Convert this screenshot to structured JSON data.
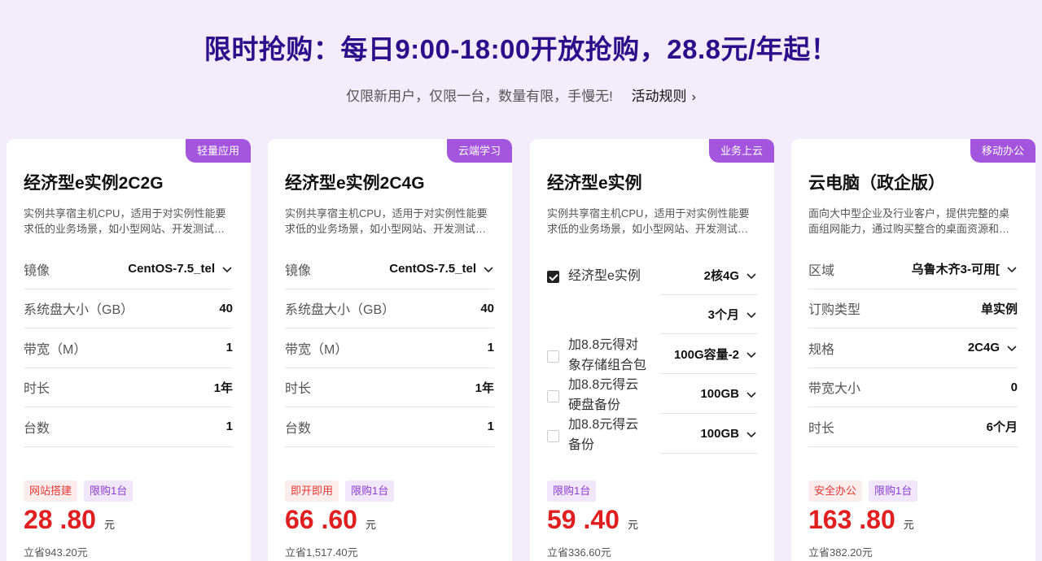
{
  "header": {
    "headline": "限时抢购：每日9:00-18:00开放抢购，28.8元/年起！",
    "subline": "仅限新用户，仅限一台，数量有限，手慢无!",
    "rules_link": "活动规则"
  },
  "cards": [
    {
      "tag": "轻量应用",
      "title": "经济型e实例2C2G",
      "desc": "实例共享宿主机CPU，适用于对实例性能要求低的业务场景，如小型网站、开发测试环境",
      "rows": [
        {
          "label": "镜像",
          "value": "CentOS-7.5_tel"
        },
        {
          "label": "系统盘大小（GB）",
          "value": "40"
        },
        {
          "label": "带宽（M）",
          "value": "1"
        },
        {
          "label": "时长",
          "value": "1年"
        },
        {
          "label": "台数",
          "value": "1"
        }
      ],
      "badges": [
        "网站搭建",
        "限购1台"
      ],
      "price": "28 .80",
      "unit": "元",
      "save": "立省943.20元"
    },
    {
      "tag": "云端学习",
      "title": "经济型e实例2C4G",
      "desc": "实例共享宿主机CPU，适用于对实例性能要求低的业务场景，如小型网站、开发测试环境",
      "rows": [
        {
          "label": "镜像",
          "value": "CentOS-7.5_tel"
        },
        {
          "label": "系统盘大小（GB）",
          "value": "40"
        },
        {
          "label": "带宽（M）",
          "value": "1"
        },
        {
          "label": "时长",
          "value": "1年"
        },
        {
          "label": "台数",
          "value": "1"
        }
      ],
      "badges": [
        "即开即用",
        "限购1台"
      ],
      "price": "66 .60",
      "unit": "元",
      "save": "立省1,517.40元"
    },
    {
      "tag": "业务上云",
      "title": "经济型e实例",
      "desc": "实例共享宿主机CPU，适用于对实例性能要求低的业务场景，如小型网站、开发测试环境",
      "options": [
        {
          "label": "经济型e实例",
          "checked": true,
          "selects": [
            "2核4G",
            "3个月"
          ]
        },
        {
          "label": "加8.8元得对象存储组合包",
          "checked": false,
          "selects": [
            "100G容量-2"
          ]
        },
        {
          "label": "加8.8元得云硬盘备份",
          "checked": false,
          "selects": [
            "100GB"
          ]
        },
        {
          "label": "加8.8元得云备份",
          "checked": false,
          "selects": [
            "100GB"
          ]
        }
      ],
      "badges": [
        "限购1台"
      ],
      "price": "59 .40",
      "unit": "元",
      "save": "立省336.60元"
    },
    {
      "tag": "移动办公",
      "title": "云电脑（政企版）",
      "desc": "面向大中型企业及行业客户，提供完整的桌面组网能力，通过购买整合的桌面资源和网络",
      "rows": [
        {
          "label": "区域",
          "value": "乌鲁木齐3-可用[",
          "dropdown": true
        },
        {
          "label": "订购类型",
          "value": "单实例",
          "dropdown": false
        },
        {
          "label": "规格",
          "value": "2C4G",
          "dropdown": true
        },
        {
          "label": "带宽大小",
          "value": "0",
          "dropdown": false
        },
        {
          "label": "时长",
          "value": "6个月",
          "dropdown": false
        }
      ],
      "badges": [
        "安全办公",
        "限购1台"
      ],
      "price": "163 .80",
      "unit": "元",
      "save": "立省382.20元"
    }
  ]
}
